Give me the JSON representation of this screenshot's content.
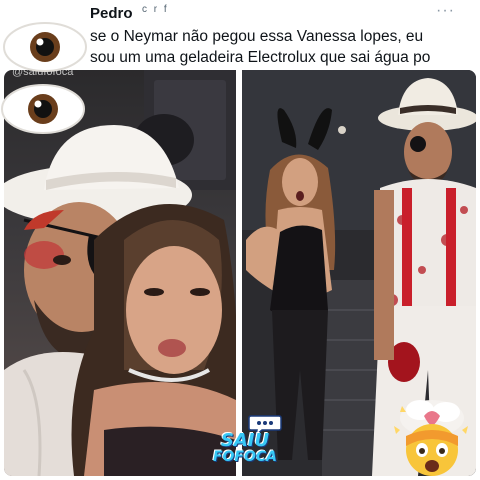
{
  "post": {
    "username": "Pedro",
    "handle": "c r f",
    "more_label": "···",
    "text_lines": [
      "se o Neymar não pegou essa Vanessa lopes, eu",
      "sou um uma geladeira Electrolux que sai água po"
    ]
  },
  "photos": {
    "left_watermark": "@saiufofoca"
  },
  "brand": {
    "line1": "SAIU",
    "line2": "FOFOCA"
  },
  "colors": {
    "brand_blue": "#37c8f5",
    "text_dark": "#0f1419",
    "handle_gray": "#536471"
  },
  "icons": [
    "eye-emoji-icon",
    "chat-bubble-icon",
    "exploding-head-emoji-icon"
  ]
}
